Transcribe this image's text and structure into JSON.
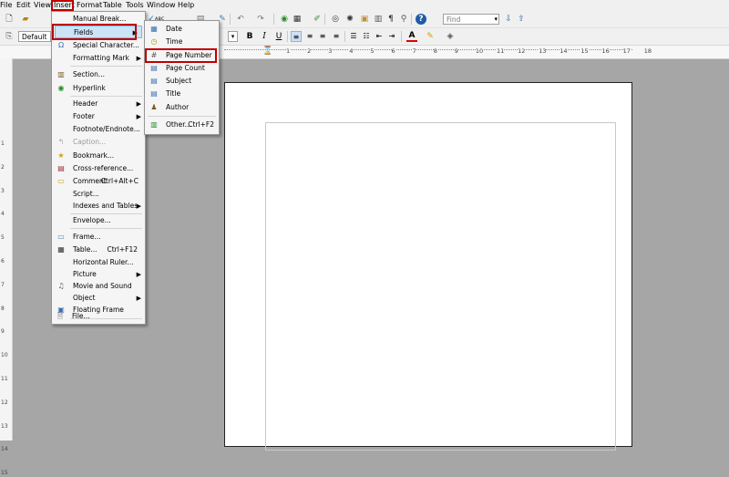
{
  "menubar": {
    "items": [
      "File",
      "Edit",
      "View",
      "Insert",
      "Format",
      "Table",
      "Tools",
      "Window",
      "Help"
    ]
  },
  "toolbar": {
    "style_value": "Default",
    "find_placeholder": "Find",
    "bold": "B",
    "italic": "I",
    "underline": "U"
  },
  "ruler": {
    "numbers": [
      "1",
      "2",
      "3",
      "4",
      "5",
      "6",
      "7",
      "8",
      "9",
      "10",
      "11",
      "12",
      "13",
      "14",
      "15",
      "16",
      "17",
      "18"
    ]
  },
  "vruler": {
    "numbers": [
      "1",
      "2",
      "3",
      "4",
      "5",
      "6",
      "7",
      "8",
      "9",
      "10",
      "11",
      "12",
      "13",
      "14",
      "15"
    ]
  },
  "insert_menu": {
    "items": [
      {
        "label": "Manual Break...",
        "shortcut": "",
        "icon": "",
        "disabled": false
      },
      {
        "label": "Fields",
        "shortcut": "",
        "icon": "",
        "disabled": false,
        "submenu": true,
        "highlighted": true
      },
      {
        "label": "Special Character...",
        "shortcut": "",
        "icon": "omega-icon",
        "disabled": false
      },
      {
        "label": "Formatting Mark",
        "shortcut": "",
        "icon": "",
        "disabled": false,
        "submenu": true
      },
      {
        "label": "Section...",
        "shortcut": "",
        "icon": "section-icon",
        "disabled": false
      },
      {
        "label": "Hyperlink",
        "shortcut": "",
        "icon": "globe-icon",
        "disabled": false
      },
      {
        "label": "Header",
        "shortcut": "",
        "icon": "",
        "disabled": false,
        "submenu": true
      },
      {
        "label": "Footer",
        "shortcut": "",
        "icon": "",
        "disabled": false,
        "submenu": true
      },
      {
        "label": "Footnote/Endnote...",
        "shortcut": "",
        "icon": "",
        "disabled": false
      },
      {
        "label": "Caption...",
        "shortcut": "",
        "icon": "caption-icon",
        "disabled": true
      },
      {
        "label": "Bookmark...",
        "shortcut": "",
        "icon": "bookmark-icon",
        "disabled": false
      },
      {
        "label": "Cross-reference...",
        "shortcut": "",
        "icon": "cross-reference-icon",
        "disabled": false
      },
      {
        "label": "Comment",
        "shortcut": "Ctrl+Alt+C",
        "icon": "comment-icon",
        "disabled": false
      },
      {
        "label": "Script...",
        "shortcut": "",
        "icon": "",
        "disabled": false
      },
      {
        "label": "Indexes and Tables",
        "shortcut": "",
        "icon": "",
        "disabled": false,
        "submenu": true
      },
      {
        "label": "Envelope...",
        "shortcut": "",
        "icon": "",
        "disabled": false
      },
      {
        "label": "Frame...",
        "shortcut": "",
        "icon": "frame-icon",
        "disabled": false
      },
      {
        "label": "Table...",
        "shortcut": "Ctrl+F12",
        "icon": "table-icon",
        "disabled": false
      },
      {
        "label": "Horizontal Ruler...",
        "shortcut": "",
        "icon": "",
        "disabled": false
      },
      {
        "label": "Picture",
        "shortcut": "",
        "icon": "",
        "disabled": false,
        "submenu": true
      },
      {
        "label": "Movie and Sound",
        "shortcut": "",
        "icon": "movie-icon",
        "disabled": false
      },
      {
        "label": "Object",
        "shortcut": "",
        "icon": "",
        "disabled": false,
        "submenu": true
      },
      {
        "label": "Floating Frame",
        "shortcut": "",
        "icon": "floating-frame-icon",
        "disabled": false
      },
      {
        "label": "File...",
        "shortcut": "",
        "icon": "file-icon",
        "disabled": false
      }
    ]
  },
  "fields_menu": {
    "items": [
      {
        "label": "Date",
        "shortcut": "",
        "icon": "calendar-icon"
      },
      {
        "label": "Time",
        "shortcut": "",
        "icon": "clock-icon"
      },
      {
        "label": "Page Number",
        "shortcut": "",
        "icon": "page-number-icon",
        "highlighted": true
      },
      {
        "label": "Page Count",
        "shortcut": "",
        "icon": "page-count-icon"
      },
      {
        "label": "Subject",
        "shortcut": "",
        "icon": "subject-icon"
      },
      {
        "label": "Title",
        "shortcut": "",
        "icon": "title-icon"
      },
      {
        "label": "Author",
        "shortcut": "",
        "icon": "author-icon"
      },
      {
        "label": "Other...",
        "shortcut": "Ctrl+F2",
        "icon": "other-fields-icon"
      }
    ]
  },
  "colors": {
    "highlight_border": "#c00000",
    "menu_highlight": "#cce4f7"
  }
}
